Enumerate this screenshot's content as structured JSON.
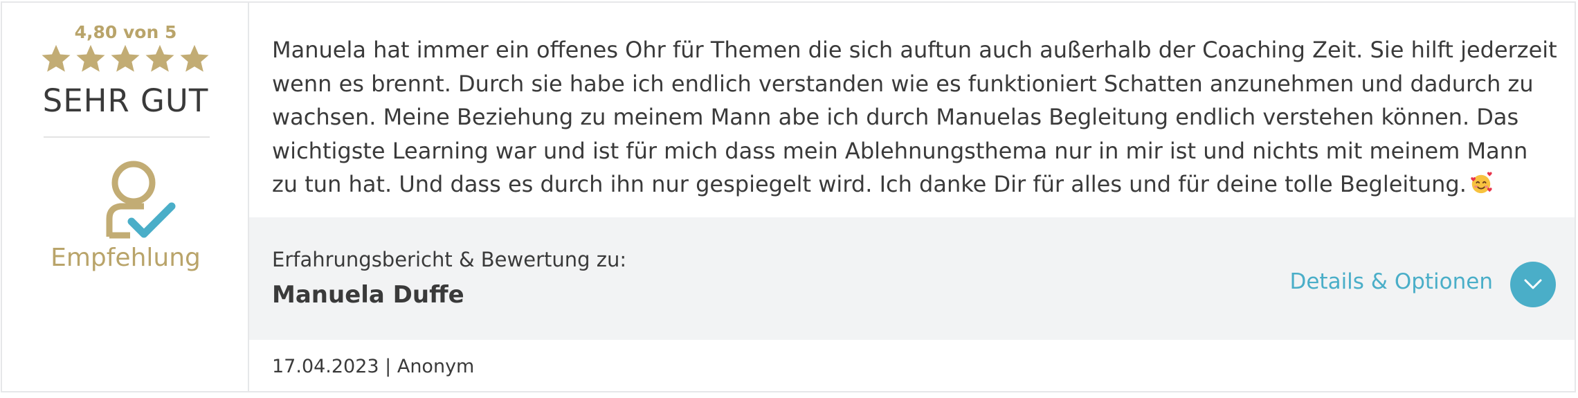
{
  "rating": {
    "score_text": "4,80 von 5",
    "value": 4.8,
    "max": 5,
    "verdict": "SEHR GUT",
    "star_color": "#c2ac74",
    "recommend_label": "Empfehlung",
    "recommend_icon": "user-check-icon"
  },
  "review": {
    "text": "Manuela hat immer ein offenes Ohr für Themen die sich auftun auch außerhalb der Coaching Zeit. Sie hilft jederzeit wenn es brennt. Durch sie habe ich endlich verstanden wie es funktioniert Schatten anzunehmen und dadurch zu wachsen. Meine Beziehung zu meinem Mann abe ich durch Manuelas Begleitung endlich verstehen können. Das wichtigste Learning war und ist für mich dass mein Ablehnungsthema nur in mir ist und nichts mit meinem Mann zu tun hat. Und dass es durch ihn nur gespiegelt wird. Ich danke Dir für alles und für deine tolle Begleitung.",
    "emoji_icon": "smiling-face-with-hearts-icon"
  },
  "subject": {
    "caption": "Erfahrungsbericht & Bewertung zu:",
    "name": "Manuela Duffe"
  },
  "actions": {
    "details_label": "Details & Optionen",
    "details_icon": "chevron-down-icon",
    "accent_color": "#4aaec8"
  },
  "meta": {
    "line": "17.04.2023 | Anonym"
  }
}
